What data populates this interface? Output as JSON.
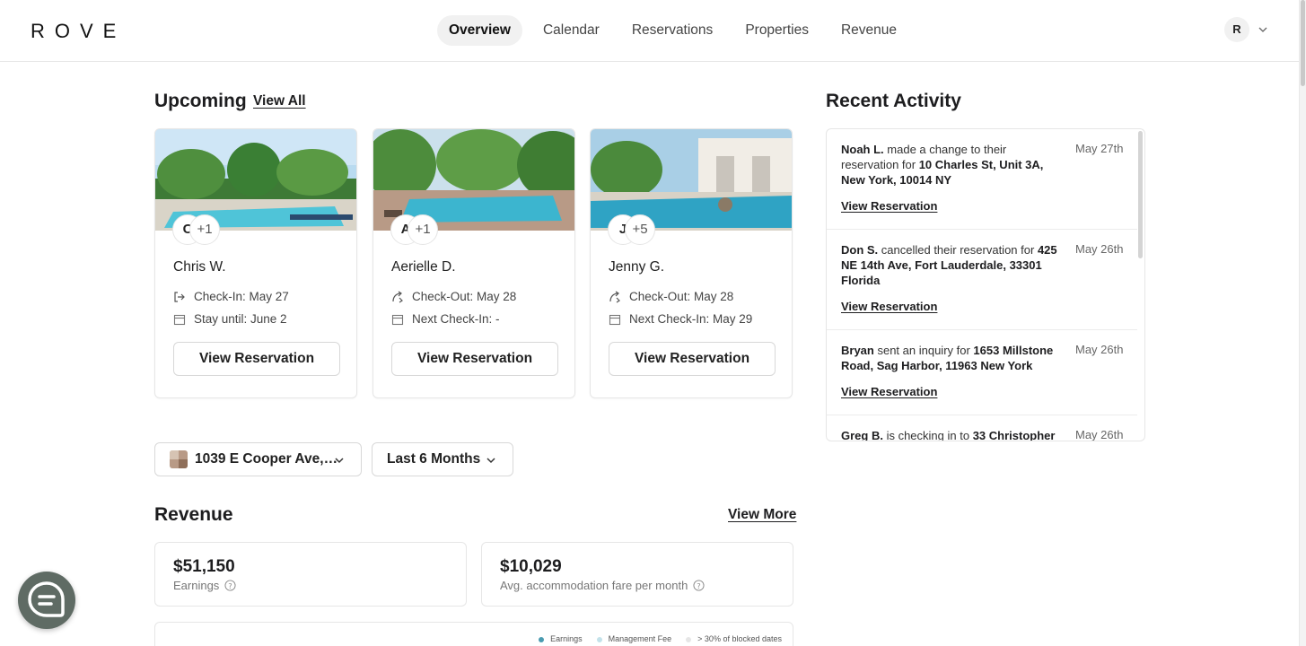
{
  "app": {
    "logo": "ROVE",
    "nav": [
      "Overview",
      "Calendar",
      "Reservations",
      "Properties",
      "Revenue"
    ],
    "active_nav": "Overview",
    "account_initial": "R"
  },
  "upcoming": {
    "title": "Upcoming",
    "view_all": "View All",
    "cards": [
      {
        "guest_initial": "C",
        "extra_guests": "+1",
        "name": "Chris W.",
        "line1": "Check-In: May 27",
        "line1_icon": "check-in-icon",
        "line2": "Stay until: June 2",
        "button": "View Reservation"
      },
      {
        "guest_initial": "A",
        "extra_guests": "+1",
        "name": "Aerielle D.",
        "line1": "Check-Out: May 28",
        "line1_icon": "check-out-icon",
        "line2": "Next Check-In: -",
        "button": "View Reservation"
      },
      {
        "guest_initial": "J",
        "extra_guests": "+5",
        "name": "Jenny G.",
        "line1": "Check-Out: May 28",
        "line1_icon": "check-out-icon",
        "line2": "Next Check-In: May 29",
        "button": "View Reservation"
      }
    ]
  },
  "activity": {
    "title": "Recent Activity",
    "items": [
      {
        "who": "Noah L.",
        "action": " made a change to their reservation for ",
        "where": "10 Charles St, Unit 3A, New York, 10014 NY",
        "date": "May 27th",
        "link": "View Reservation"
      },
      {
        "who": "Don S.",
        "action": " cancelled their reservation for ",
        "where": "425 NE 14th Ave, Fort Lauderdale, 33301 Florida",
        "date": "May 26th",
        "link": "View Reservation"
      },
      {
        "who": "Bryan",
        "action": " sent an inquiry for ",
        "where": "1653 Millstone Road, Sag Harbor, 11963 New York",
        "date": "May 26th",
        "link": "View Reservation"
      },
      {
        "who": "Greg B.",
        "action": " is checking in to ",
        "where": "33 Christopher",
        "date": "May 26th",
        "link": ""
      }
    ]
  },
  "filters": {
    "property": "1039 E Cooper Ave,…",
    "period": "Last 6 Months"
  },
  "revenue": {
    "title": "Revenue",
    "view_more": "View More",
    "earnings_value": "$51,150",
    "earnings_label": "Earnings",
    "avg_value": "$10,029",
    "avg_label": "Avg. accommodation fare per month",
    "legend": [
      {
        "label": "Earnings",
        "color": "#4a9bb0"
      },
      {
        "label": "Management Fee",
        "color": "#c3e2ea"
      },
      {
        "label": "> 30% of blocked dates",
        "color": "#e6e6e6"
      }
    ]
  }
}
